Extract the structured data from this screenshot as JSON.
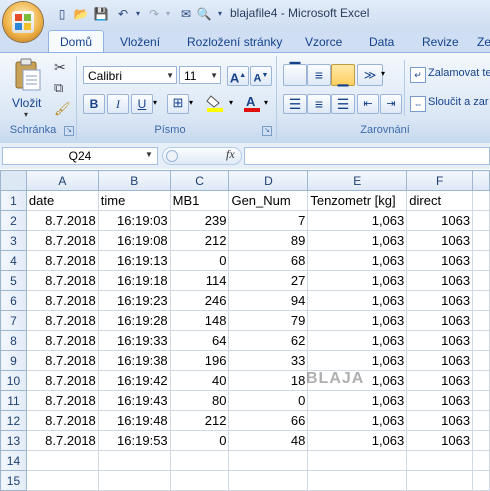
{
  "window": {
    "title": "blajafile4 - Microsoft Excel"
  },
  "ribbon": {
    "tabs": [
      "Domů",
      "Vložení",
      "Rozložení stránky",
      "Vzorce",
      "Data",
      "Revize",
      "Ze"
    ],
    "groups": {
      "clipboard": "Schránka",
      "font": "Písmo",
      "alignment": "Zarovnání"
    },
    "paste_label": "Vložit",
    "font_name": "Calibri",
    "font_size": "11",
    "wrap_text": "Zalamovat te",
    "merge_cells": "Sloučit a zar"
  },
  "formula_bar": {
    "name_box": "Q24",
    "fx": "fx",
    "formula": ""
  },
  "sheet": {
    "columns": [
      "A",
      "B",
      "C",
      "D",
      "E",
      "F"
    ],
    "row_numbers": [
      "1",
      "2",
      "3",
      "4",
      "5",
      "6",
      "7",
      "8",
      "9",
      "10",
      "11",
      "12",
      "13",
      "14",
      "15"
    ],
    "header_row": [
      "date",
      "time",
      "MB1",
      "Gen_Num",
      "Tenzometr [kg]",
      "direct"
    ],
    "rows": [
      [
        "8.7.2018",
        "16:19:03",
        "239",
        "7",
        "1,063",
        "1063"
      ],
      [
        "8.7.2018",
        "16:19:08",
        "212",
        "89",
        "1,063",
        "1063"
      ],
      [
        "8.7.2018",
        "16:19:13",
        "0",
        "68",
        "1,063",
        "1063"
      ],
      [
        "8.7.2018",
        "16:19:18",
        "114",
        "27",
        "1,063",
        "1063"
      ],
      [
        "8.7.2018",
        "16:19:23",
        "246",
        "94",
        "1,063",
        "1063"
      ],
      [
        "8.7.2018",
        "16:19:28",
        "148",
        "79",
        "1,063",
        "1063"
      ],
      [
        "8.7.2018",
        "16:19:33",
        "64",
        "62",
        "1,063",
        "1063"
      ],
      [
        "8.7.2018",
        "16:19:38",
        "196",
        "33",
        "1,063",
        "1063"
      ],
      [
        "8.7.2018",
        "16:19:42",
        "40",
        "18",
        "1,063",
        "1063"
      ],
      [
        "8.7.2018",
        "16:19:43",
        "80",
        "0",
        "1,063",
        "1063"
      ],
      [
        "8.7.2018",
        "16:19:48",
        "212",
        "66",
        "1,063",
        "1063"
      ],
      [
        "8.7.2018",
        "16:19:53",
        "0",
        "48",
        "1,063",
        "1063"
      ]
    ]
  },
  "watermark": "BLAJA",
  "colors": {
    "ribbon_blue": "#dbe7f5",
    "header_text": "#1f3f6f",
    "accent": "#15428b"
  }
}
